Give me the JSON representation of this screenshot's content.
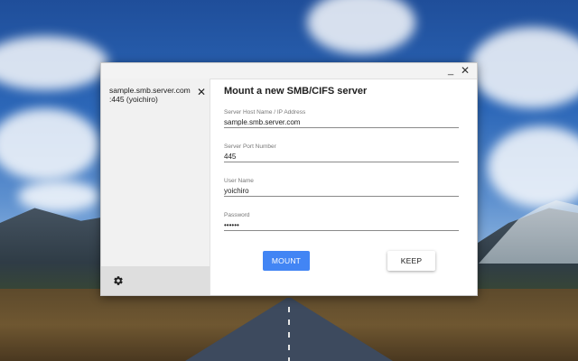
{
  "window": {
    "minimize_glyph": "_",
    "close_glyph": "✕"
  },
  "sidebar": {
    "entry": {
      "line1": "sample.smb.server.com",
      "line2": ":445 (yoichiro)",
      "close_glyph": "✕"
    },
    "settings_icon": "gear-icon"
  },
  "main": {
    "title": "Mount a new SMB/CIFS server",
    "fields": {
      "host": {
        "label": "Server Host Name / IP Address",
        "value": "sample.smb.server.com"
      },
      "port": {
        "label": "Server Port Number",
        "value": "445"
      },
      "user": {
        "label": "User Name",
        "value": "yoichiro"
      },
      "password": {
        "label": "Password",
        "value": "••••••"
      }
    },
    "buttons": {
      "mount": "MOUNT",
      "keep": "KEEP"
    }
  },
  "colors": {
    "accent": "#4285f4",
    "sidebar_bg": "#f1f1f1",
    "sidebar_footer_bg": "#dedede"
  }
}
